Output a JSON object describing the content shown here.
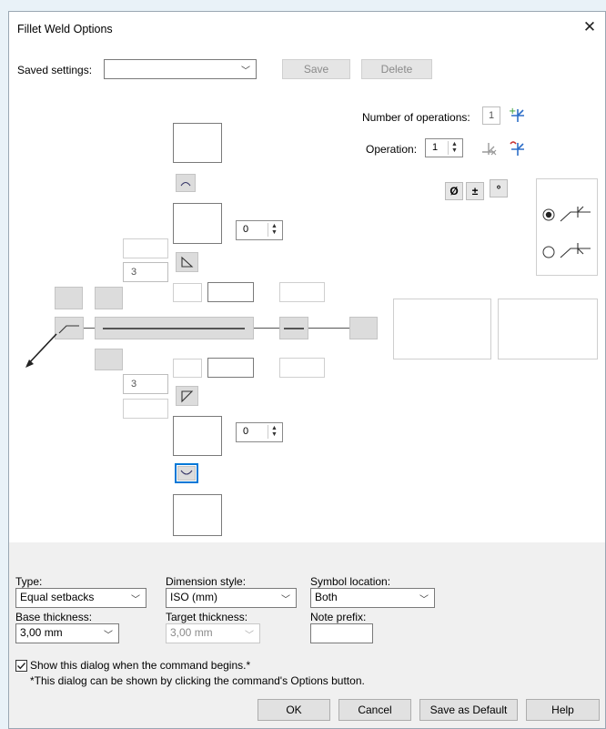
{
  "dialog": {
    "title": "Fillet Weld Options",
    "close_glyph": "✕"
  },
  "saved": {
    "label": "Saved settings:",
    "value": "",
    "save_label": "Save",
    "delete_label": "Delete"
  },
  "ops": {
    "count_label": "Number of operations:",
    "count_value": "1",
    "op_label": "Operation:",
    "op_value": "1"
  },
  "symbols": {
    "diameter": "Ø",
    "plus_minus": "±",
    "degree": "°"
  },
  "weld": {
    "top_spin_value": "0",
    "bottom_spin_value": "0",
    "top_leg": "3",
    "bottom_leg": "3"
  },
  "options": {
    "type_label": "Type:",
    "type_value": "Equal setbacks",
    "dim_label": "Dimension style:",
    "dim_value": "ISO (mm)",
    "loc_label": "Symbol location:",
    "loc_value": "Both",
    "base_label": "Base thickness:",
    "base_value": "3,00 mm",
    "target_label": "Target thickness:",
    "target_value": "3,00 mm",
    "note_label": "Note prefix:",
    "note_value": ""
  },
  "show_dialog": {
    "checked": true,
    "label": "Show this dialog when the command begins.*",
    "note": "*This dialog can be shown by clicking the command's Options button."
  },
  "buttons": {
    "ok": "OK",
    "cancel": "Cancel",
    "save_default": "Save as Default",
    "help": "Help"
  },
  "colors": {
    "accent": "#0078d7",
    "symbol_green": "#2e9b2e",
    "symbol_red": "#c83232"
  }
}
